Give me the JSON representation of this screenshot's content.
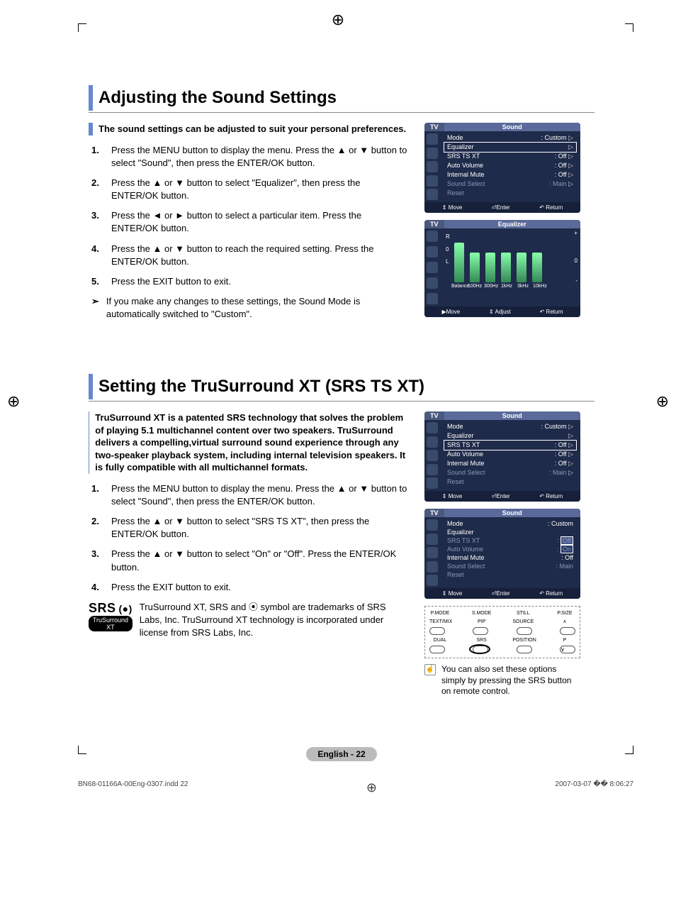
{
  "section1": {
    "title": "Adjusting the Sound Settings",
    "intro": "The sound settings can be adjusted to suit your personal preferences.",
    "steps": [
      "Press the MENU button to display the menu. Press the ▲ or ▼ button to select \"Sound\", then press the ENTER/OK button.",
      "Press the ▲ or ▼ button to select \"Equalizer\", then press the ENTER/OK button.",
      "Press the ◄ or ► button to select a particular item. Press the ENTER/OK button.",
      "Press the ▲ or ▼ button to reach the required setting. Press the ENTER/OK button.",
      "Press the EXIT button to exit."
    ],
    "note_marker": "➣",
    "note": "If you make any changes to these settings, the Sound Mode is automatically switched to \"Custom\"."
  },
  "section2": {
    "title": "Setting the TruSurround XT (SRS TS XT)",
    "intro": "TruSurround XT is a patented SRS technology that solves the problem of playing 5.1 multichannel content over two speakers. TruSurround delivers a compelling,virtual surround sound experience through any two-speaker playback system, including internal television speakers. It is fully compatible with all multichannel formats.",
    "steps": [
      "Press the MENU button to display the menu. Press the ▲ or ▼ button to select \"Sound\", then press the ENTER/OK button.",
      "Press the ▲ or ▼ button to select \"SRS TS XT\", then press the ENTER/OK button.",
      "Press the ▲ or ▼ button to select \"On\" or \"Off\". Press the ENTER/OK button.",
      "Press the EXIT button to exit."
    ],
    "srs_text": "TruSurround XT, SRS and ⦿ symbol are trademarks of SRS Labs, Inc. TruSurround XT technology is incorporated under license from SRS Labs, Inc.",
    "srs_logo_top": "SRS",
    "srs_logo_bot": "TruSurround XT",
    "tip": "You can also set these options simply by pressing the SRS button on remote control.",
    "tip_icon": "☝"
  },
  "osd1": {
    "tab": "TV",
    "title": "Sound",
    "rows": [
      {
        "label": "Mode",
        "value": ": Custom",
        "dim": false,
        "hl": false
      },
      {
        "label": "Equalizer",
        "value": "",
        "dim": false,
        "hl": true
      },
      {
        "label": "SRS TS XT",
        "value": ": Off",
        "dim": false,
        "hl": false
      },
      {
        "label": "Auto Volume",
        "value": ": Off",
        "dim": false,
        "hl": false
      },
      {
        "label": "Internal Mute",
        "value": ": Off",
        "dim": false,
        "hl": false
      },
      {
        "label": "Sound Select",
        "value": ": Main",
        "dim": true,
        "hl": false
      },
      {
        "label": "Reset",
        "value": "",
        "dim": true,
        "hl": false
      }
    ],
    "footer": [
      "⇕ Move",
      "⏎Enter",
      "↶ Return"
    ]
  },
  "osd_eq": {
    "tab": "TV",
    "title": "Equalizer",
    "bands": [
      "Balance",
      "100Hz",
      "300Hz",
      "1kHz",
      "3kHz",
      "10kHz"
    ],
    "side_top": "R",
    "side_mid": "0",
    "side_bot": "L",
    "right_plus": "+",
    "right_zero": "0",
    "right_minus": "-",
    "footer": [
      "▶Move",
      "⇕ Adjust",
      "↶ Return"
    ]
  },
  "osd2": {
    "tab": "TV",
    "title": "Sound",
    "rows": [
      {
        "label": "Mode",
        "value": ": Custom",
        "dim": false,
        "hl": false
      },
      {
        "label": "Equalizer",
        "value": "",
        "dim": false,
        "hl": false
      },
      {
        "label": "SRS TS XT",
        "value": ": Off",
        "dim": false,
        "hl": true
      },
      {
        "label": "Auto Volume",
        "value": ": Off",
        "dim": false,
        "hl": false
      },
      {
        "label": "Internal Mute",
        "value": ": Off",
        "dim": false,
        "hl": false
      },
      {
        "label": "Sound Select",
        "value": ": Main",
        "dim": true,
        "hl": false
      },
      {
        "label": "Reset",
        "value": "",
        "dim": true,
        "hl": false
      }
    ],
    "footer": [
      "⇕ Move",
      "⏎Enter",
      "↶ Return"
    ]
  },
  "osd3": {
    "tab": "TV",
    "title": "Sound",
    "rows": [
      {
        "label": "Mode",
        "value": ": Custom",
        "dim": false
      },
      {
        "label": "Equalizer",
        "value": "",
        "dim": false
      },
      {
        "label": "SRS TS XT",
        "value": ":",
        "dim": true,
        "dropdown": true
      },
      {
        "label": "Auto Volume",
        "value": ":",
        "dim": true
      },
      {
        "label": "Internal Mute",
        "value": ": Off",
        "dim": false
      },
      {
        "label": "Sound Select",
        "value": ": Main",
        "dim": true
      },
      {
        "label": "Reset",
        "value": "",
        "dim": true
      }
    ],
    "dropdown": {
      "opt1": "Off",
      "opt2": "On"
    },
    "footer": [
      "⇕ Move",
      "⏎Enter",
      "↶ Return"
    ]
  },
  "remote": {
    "row1": [
      "P.MODE",
      "S.MODE",
      "STILL",
      "P.SIZE"
    ],
    "row2": [
      "TEXT/MIX",
      "PIP",
      "SOURCE",
      ""
    ],
    "row3": [
      "DUAL",
      "SRS",
      "POSITION",
      "P"
    ]
  },
  "footer_pill": "English - 22",
  "print": {
    "left": "BN68-01166A-00Eng-0307.indd   22",
    "right": "2007-03-07   �� 8:06:27"
  }
}
